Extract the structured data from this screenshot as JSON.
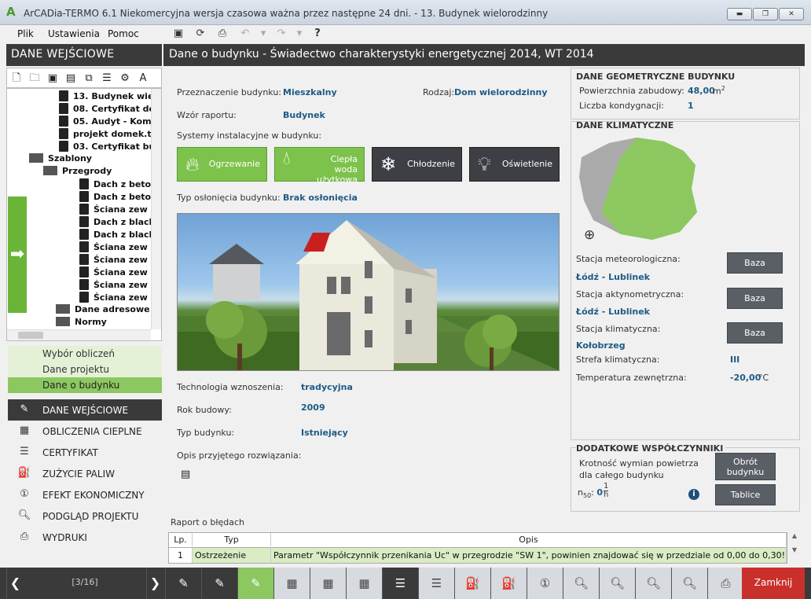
{
  "window": {
    "title": "ArCADia-TERMO 6.1 Niekomercyjna wersja czasowa ważna przez następne 24 dni. - 13. Budynek wielorodzinny"
  },
  "menu": [
    "Plik",
    "Ustawienia",
    "Pomoc"
  ],
  "left": {
    "header": "DANE WEJŚCIOWE",
    "tree": [
      {
        "label": "13. Budynek wie"
      },
      {
        "label": "08. Certyfikat do"
      },
      {
        "label": "05. Audyt - Komp"
      },
      {
        "label": "projekt domek.t"
      },
      {
        "label": "03. Certyfikat bu"
      },
      {
        "label": "Szablony"
      },
      {
        "label": "Przegrody"
      },
      {
        "label": "Dach z beto"
      },
      {
        "label": "Dach z beto"
      },
      {
        "label": "Ściana zew"
      },
      {
        "label": "Dach z blach"
      },
      {
        "label": "Dach z blach"
      },
      {
        "label": "Ściana zew"
      },
      {
        "label": "Ściana zew"
      },
      {
        "label": "Ściana zew"
      },
      {
        "label": "Ściana zew"
      },
      {
        "label": "Ściana zew"
      },
      {
        "label": "Dane adresowe"
      },
      {
        "label": "Normy"
      }
    ],
    "subnav": [
      "Wybór obliczeń",
      "Dane projektu",
      "Dane o budynku"
    ],
    "nav": [
      "DANE WEJŚCIOWE",
      "OBLICZENIA CIEPLNE",
      "CERTYFIKAT",
      "ZUŻYCIE PALIW",
      "EFEKT EKONOMICZNY",
      "PODGLĄD PROJEKTU",
      "WYDRUKI"
    ]
  },
  "main": {
    "header": "Dane o budynku - Świadectwo charakterystyki energetycznej 2014, WT 2014",
    "przeznaczenie_label": "Przeznaczenie budynku:",
    "przeznaczenie_value": "Mieszkalny",
    "rodzaj_label": "Rodzaj:",
    "rodzaj_value": "Dom wielorodzinny",
    "wzor_label": "Wzór raportu:",
    "wzor_value": "Budynek",
    "systemy_label": "Systemy instalacyjne w budynku:",
    "systems": [
      {
        "label": "Ogrzewanie",
        "color": "#7dc24b"
      },
      {
        "label": "Ciepła woda użytkowa",
        "color": "#7dc24b"
      },
      {
        "label": "Chłodzenie",
        "color": "#3d3f44"
      },
      {
        "label": "Oświetlenie",
        "color": "#3d3f44"
      }
    ],
    "oslona_label": "Typ osłonięcia budynku:",
    "oslona_value": "Brak osłonięcia",
    "technologia_label": "Technologia wznoszenia:",
    "technologia_value": "tradycyjna",
    "rok_label": "Rok budowy:",
    "rok_value": "2009",
    "typ_label": "Typ budynku:",
    "typ_value": "Istniejący",
    "opis_label": "Opis przyjętego rozwiązania:"
  },
  "geom": {
    "title": "DANE GEOMETRYCZNE BUDYNKU",
    "area_label": "Powierzchnia zabudowy:",
    "area_value": "48,00",
    "area_unit": "m",
    "area_sup": "2",
    "floors_label": "Liczba kondygnacji:",
    "floors_value": "1"
  },
  "climate": {
    "title": "DANE KLIMATYCZNE",
    "meteo_label": "Stacja meteorologiczna:",
    "meteo_value": "Łódź - Lublinek",
    "akty_label": "Stacja aktynometryczna:",
    "akty_value": "Łódź - Lublinek",
    "klim_label": "Stacja klimatyczna:",
    "klim_value": "Kołobrzeg",
    "strefa_label": "Strefa klimatyczna:",
    "strefa_value": "III",
    "temp_label": "Temperatura zewnętrzna:",
    "temp_value": "-20,00",
    "temp_unit": "°C",
    "baza_label": "Baza"
  },
  "extra": {
    "title": "DODATKOWE WSPÓŁCZYNNIKI",
    "wymiany_label": "Krotność wymian powietrza dla całego budynku",
    "n50_label": "n",
    "n50_sub": "50",
    "n50_value": "0",
    "unit_num": "1",
    "unit_den": "h",
    "obrot_btn": "Obrót budynku",
    "tablice_btn": "Tablice"
  },
  "errors": {
    "title": "Raport o błędach",
    "columns": [
      "Lp.",
      "Typ",
      "Opis"
    ],
    "rows": [
      {
        "lp": "1",
        "typ": "Ostrzeżenie",
        "opis": "Parametr \"Współczynnik przenikania Uc\" w przegrodzie \"SW 1\", powinien znajdować się w przedziale od 0,00 do 0,30!"
      }
    ]
  },
  "footer": {
    "page": "[3/16]",
    "close": "Zamknij"
  }
}
